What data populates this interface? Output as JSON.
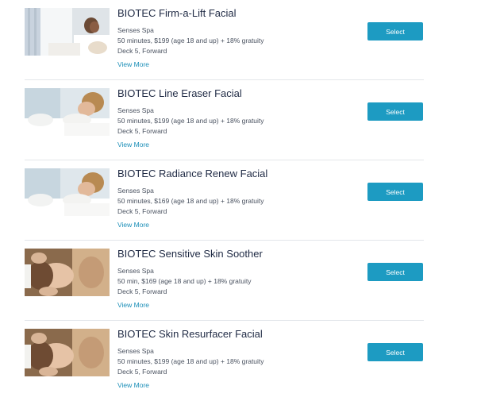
{
  "treatments": [
    {
      "title": "BIOTEC Firm-a-Lift Facial",
      "venue": "Senses Spa",
      "details": "50 minutes, $199 (age 18 and up) + 18% gratuity",
      "location": "Deck 5, Forward",
      "more_label": "View More",
      "select_label": "Select"
    },
    {
      "title": "BIOTEC Line Eraser Facial",
      "venue": "Senses Spa",
      "details": "50 minutes, $199 (age 18 and up) + 18% gratuity",
      "location": "Deck 5, Forward",
      "more_label": "View More",
      "select_label": "Select"
    },
    {
      "title": "BIOTEC Radiance Renew Facial",
      "venue": "Senses Spa",
      "details": "50 minutes, $169 (age 18 and up) + 18% gratuity",
      "location": "Deck 5, Forward",
      "more_label": "View More",
      "select_label": "Select"
    },
    {
      "title": "BIOTEC Sensitive Skin Soother",
      "venue": "Senses Spa",
      "details": "50 min, $169 (age 18 and up) + 18% gratuity",
      "location": "Deck 5, Forward",
      "more_label": "View More",
      "select_label": "Select"
    },
    {
      "title": "BIOTEC Skin Resurfacer Facial",
      "venue": "Senses Spa",
      "details": "50 minutes, $199 (age 18 and up) + 18% gratuity",
      "location": "Deck 5, Forward",
      "more_label": "View More",
      "select_label": "Select"
    }
  ],
  "colors": {
    "accent": "#1d9bc2",
    "link": "#1c8fb8",
    "title": "#1f2a44",
    "divider": "#e3e6ea"
  }
}
